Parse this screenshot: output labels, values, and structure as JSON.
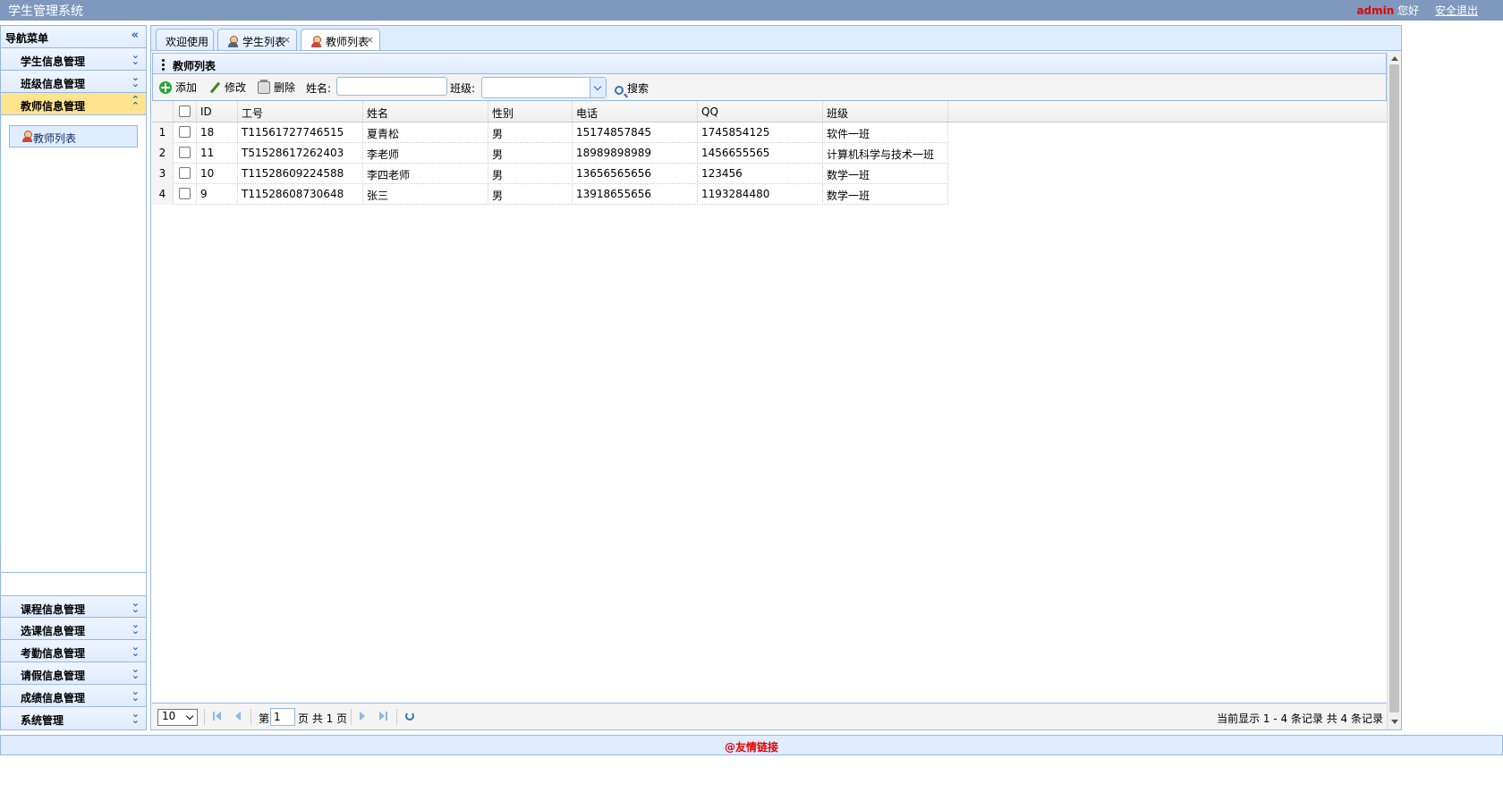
{
  "header": {
    "app_title": "学生管理系统",
    "user": "admin",
    "greeting": "您好",
    "logout": "安全退出"
  },
  "sidebar": {
    "title": "导航菜单",
    "collapse_icon": "double-chevron-left-icon",
    "groups_top": [
      {
        "label": "学生信息管理"
      },
      {
        "label": "班级信息管理"
      },
      {
        "label": "教师信息管理",
        "active": true
      }
    ],
    "active_items": [
      {
        "label": "教师列表",
        "icon": "user-icon"
      }
    ],
    "groups_bottom": [
      {
        "label": "课程信息管理"
      },
      {
        "label": "选课信息管理"
      },
      {
        "label": "考勤信息管理"
      },
      {
        "label": "请假信息管理"
      },
      {
        "label": "成绩信息管理"
      },
      {
        "label": "系统管理"
      }
    ]
  },
  "tabs": [
    {
      "label": "欢迎使用",
      "closable": false
    },
    {
      "label": "学生列表",
      "closable": true,
      "icon": "user-grey-icon"
    },
    {
      "label": "教师列表",
      "closable": true,
      "icon": "user-icon",
      "active": true
    }
  ],
  "panel": {
    "title": "教师列表"
  },
  "toolbar": {
    "add": "添加",
    "edit": "修改",
    "delete": "删除",
    "name_label": "姓名:",
    "name_value": "",
    "class_label": "班级:",
    "class_value": "",
    "search": "搜索"
  },
  "table": {
    "columns": [
      "ID",
      "工号",
      "姓名",
      "性别",
      "电话",
      "QQ",
      "班级"
    ],
    "rows": [
      {
        "num": "1",
        "id": "18",
        "sn": "T11561727746515",
        "name": "夏青松",
        "sex": "男",
        "phone": "15174857845",
        "qq": "1745854125",
        "clazz": "软件一班"
      },
      {
        "num": "2",
        "id": "11",
        "sn": "T51528617262403",
        "name": "李老师",
        "sex": "男",
        "phone": "18989898989",
        "qq": "1456655565",
        "clazz": "计算机科学与技术一班"
      },
      {
        "num": "3",
        "id": "10",
        "sn": "T11528609224588",
        "name": "李四老师",
        "sex": "男",
        "phone": "13656565656",
        "qq": "123456",
        "clazz": "数学一班"
      },
      {
        "num": "4",
        "id": "9",
        "sn": "T11528608730648",
        "name": "张三",
        "sex": "男",
        "phone": "13918655656",
        "qq": "1193284480",
        "clazz": "数学一班"
      }
    ]
  },
  "pager": {
    "page_size": "10",
    "page_prefix": "第",
    "page_value": "1",
    "page_suffix": "页 共 1 页",
    "info": "当前显示 1 - 4 条记录 共 4 条记录"
  },
  "footer": {
    "text": "@友情链接"
  },
  "colors": {
    "header_bg": "#7f99be",
    "border": "#95b8e7",
    "panel_bg": "#e0ecff",
    "active_group": "#ffe48d",
    "accent_red": "#e30000"
  }
}
